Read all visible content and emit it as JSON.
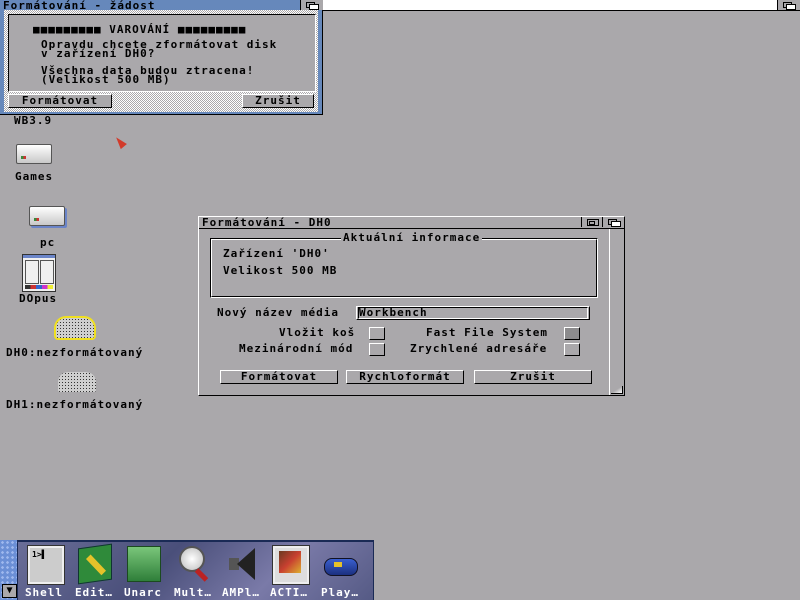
{
  "screen": {
    "title": ""
  },
  "request": {
    "title": "Formátování - žádost",
    "lines": [
      "■■■■■■■■■ VAROVÁNÍ ■■■■■■■■■",
      "Opravdu chcete zformátovat disk",
      "v zařízení DH0?",
      "Všechna data budou ztracena!",
      "(Velikost 500 MB)"
    ],
    "buttons": {
      "format": "Formátovat",
      "cancel": "Zrušit"
    }
  },
  "desktop": {
    "icons": [
      {
        "label": "WB3.9",
        "type": "drive"
      },
      {
        "label": "Games",
        "type": "drive"
      },
      {
        "label": "pc",
        "type": "drive"
      },
      {
        "label": "DOpus",
        "type": "app"
      },
      {
        "label": "DH0:nezformátovaný",
        "type": "harddisk",
        "selected": true
      },
      {
        "label": "DH1:nezformátovaný",
        "type": "harddisk",
        "selected": false
      }
    ]
  },
  "format_window": {
    "title": "Formátování - DH0",
    "info": {
      "legend": "Aktuální informace",
      "device": "Zařízení 'DH0'",
      "size": "Velikost 500 MB"
    },
    "name_label": "Nový název média",
    "name_value": "Workbench",
    "options": [
      {
        "label": "Vložit koš",
        "checked": false
      },
      {
        "label": "Fast File System",
        "checked": true
      },
      {
        "label": "Mezinárodní mód",
        "checked": false
      },
      {
        "label": "Zrychlené adresáře",
        "checked": false
      }
    ],
    "buttons": {
      "format": "Formátovat",
      "quick": "Rychloformát",
      "cancel": "Zrušit"
    }
  },
  "dock": {
    "items": [
      {
        "label": "Shell",
        "icon": "shell-icon"
      },
      {
        "label": "Edit…",
        "icon": "notepad-icon"
      },
      {
        "label": "Unarc",
        "icon": "box-icon"
      },
      {
        "label": "Mult…",
        "icon": "magnifier-icon"
      },
      {
        "label": "AMPl…",
        "icon": "speaker-icon"
      },
      {
        "label": "ACTI…",
        "icon": "film-icon"
      },
      {
        "label": "Play…",
        "icon": "player-icon"
      }
    ]
  },
  "colors": {
    "desktop": "#aaa8ab",
    "titlebar_active": "#6688bb",
    "selection": "#f0e020"
  }
}
